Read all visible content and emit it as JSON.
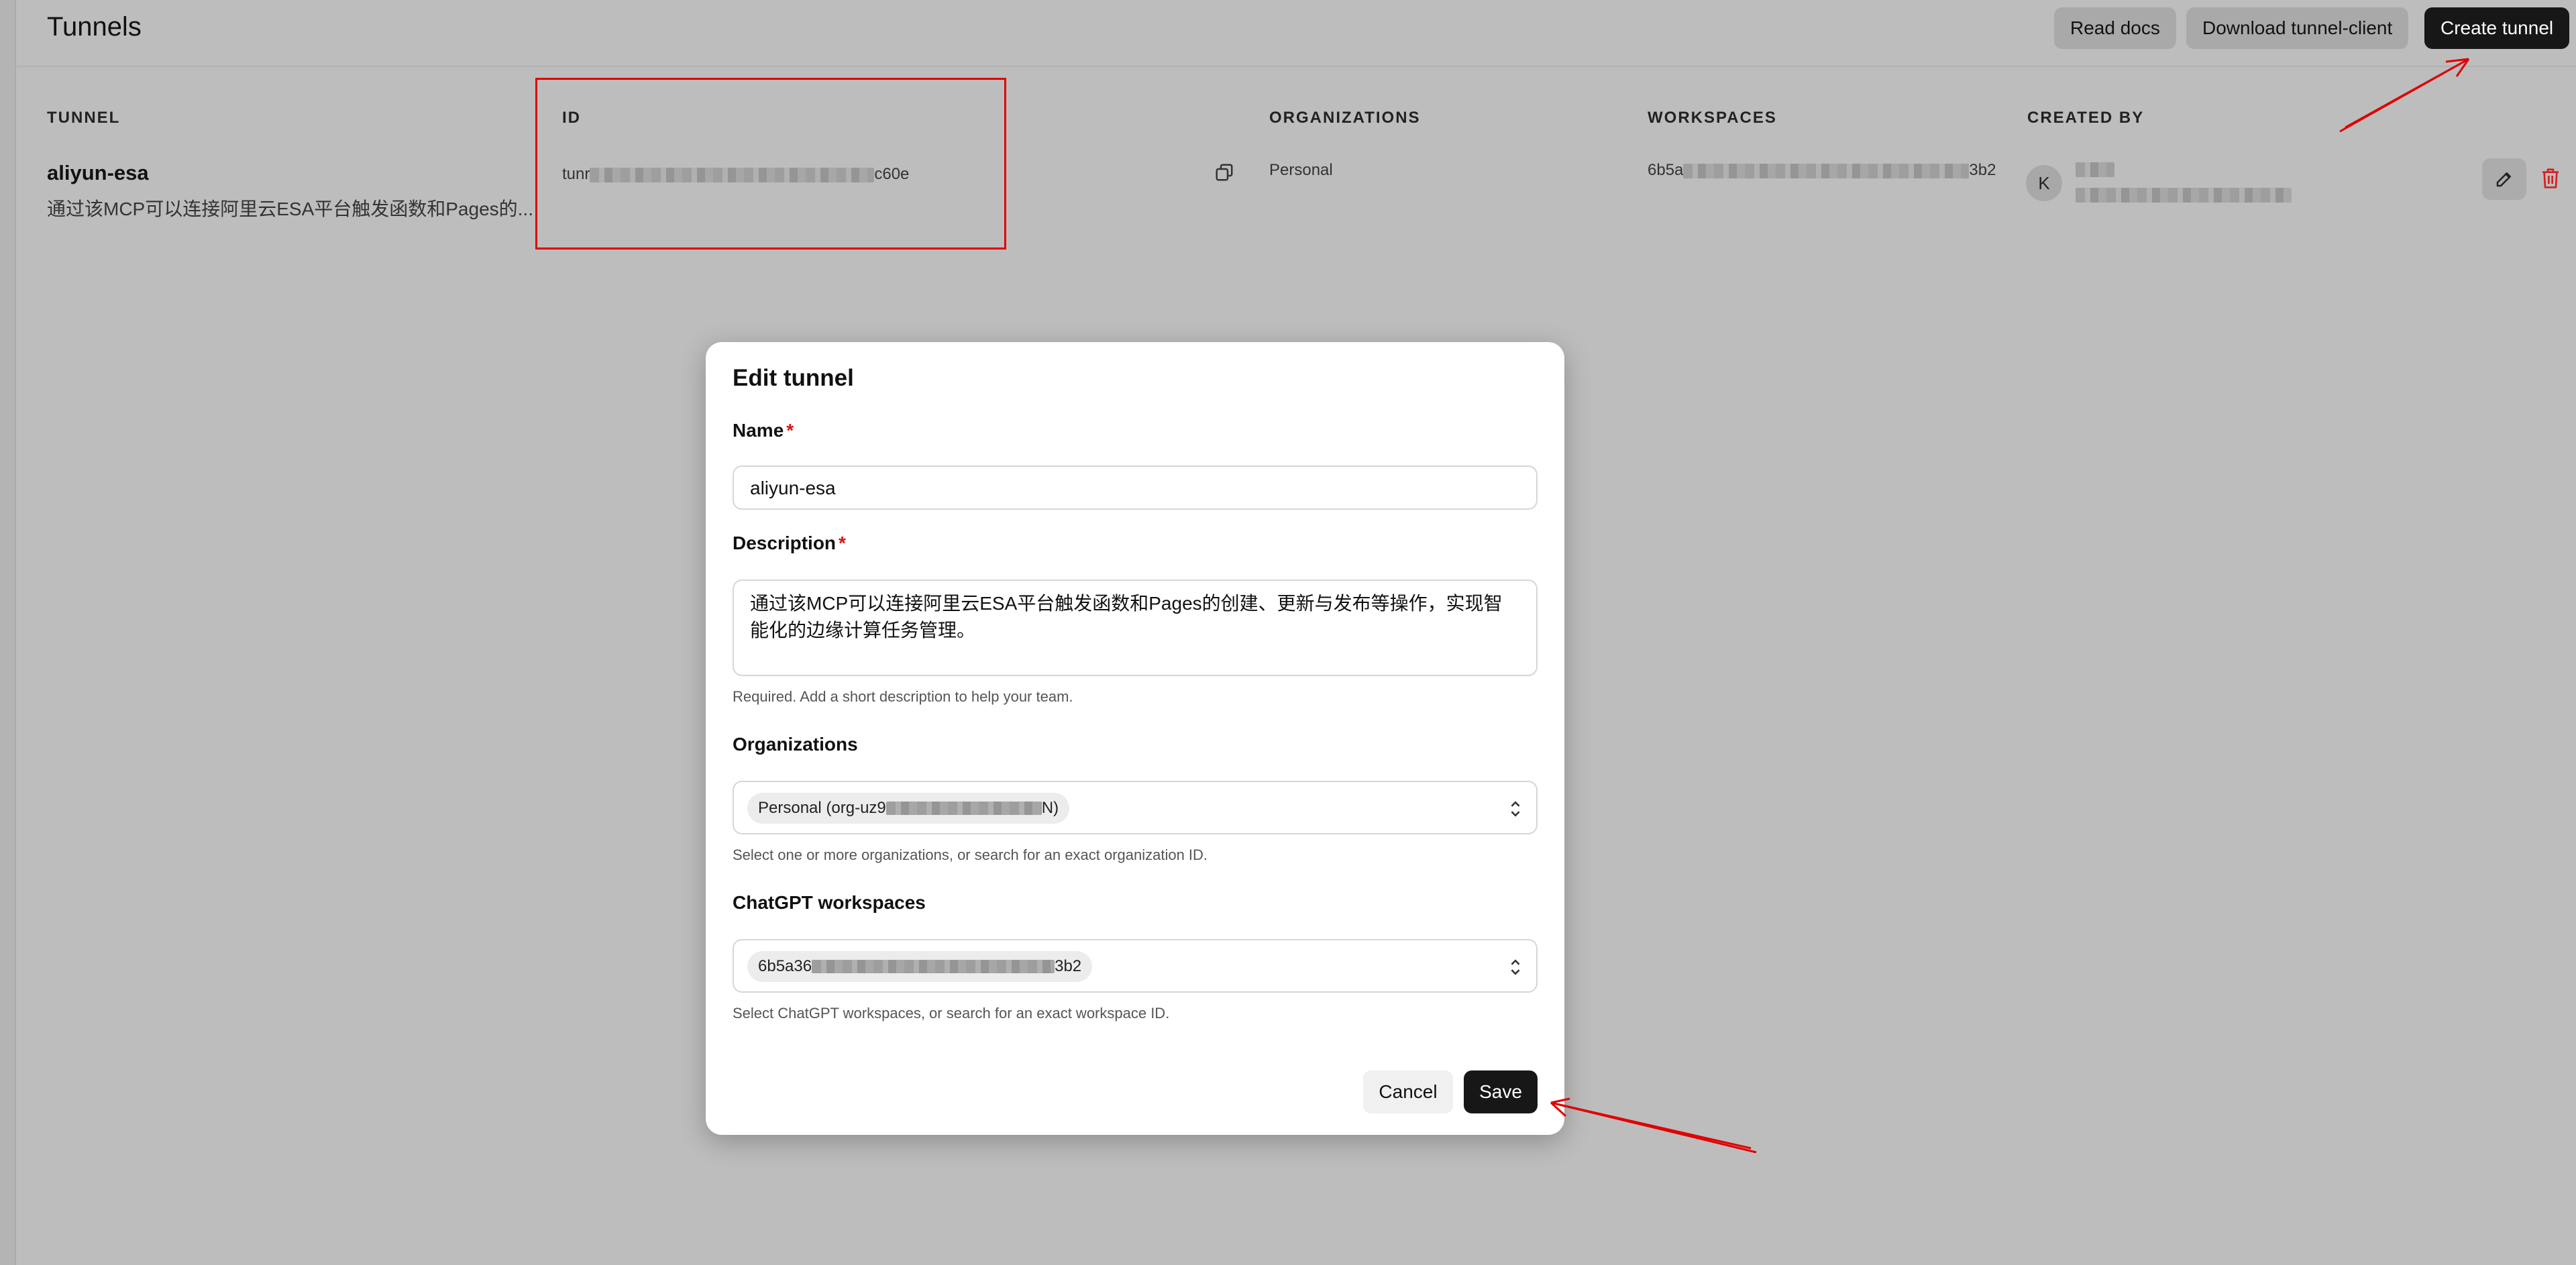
{
  "header": {
    "title": "Tunnels",
    "read_docs": "Read docs",
    "download": "Download tunnel-client",
    "create": "Create tunnel"
  },
  "table": {
    "columns": [
      "TUNNEL",
      "ID",
      "ORGANIZATIONS",
      "WORKSPACES",
      "CREATED BY"
    ],
    "row": {
      "name": "aliyun-esa",
      "description": "通过该MCP可以连接阿里云ESA平台触发函数和Pages的...",
      "id_prefix": "tunr",
      "id_suffix": "c60e",
      "organization": "Personal",
      "workspace_prefix": "6b5a",
      "workspace_suffix": "3b2",
      "creator_initial": "K"
    }
  },
  "modal": {
    "title": "Edit tunnel",
    "name_label": "Name",
    "required_mark": "*",
    "name_value": "aliyun-esa",
    "description_label": "Description",
    "description_value": "通过该MCP可以连接阿里云ESA平台触发函数和Pages的创建、更新与发布等操作，实现智能化的边缘计算任务管理。",
    "description_help": "Required. Add a short description to help your team.",
    "organizations_label": "Organizations",
    "organization_chip_prefix": "Personal (org-uz9",
    "organization_chip_suffix": "N)",
    "organizations_help": "Select one or more organizations, or search for an exact organization ID.",
    "workspaces_label": "ChatGPT workspaces",
    "workspace_chip_prefix": "6b5a36",
    "workspace_chip_suffix": "3b2",
    "workspaces_help": "Select ChatGPT workspaces, or search for an exact workspace ID.",
    "cancel": "Cancel",
    "save": "Save"
  },
  "colors": {
    "accent_dark": "#171717",
    "annotation_red": "#e00000",
    "required_red": "#d11111"
  }
}
